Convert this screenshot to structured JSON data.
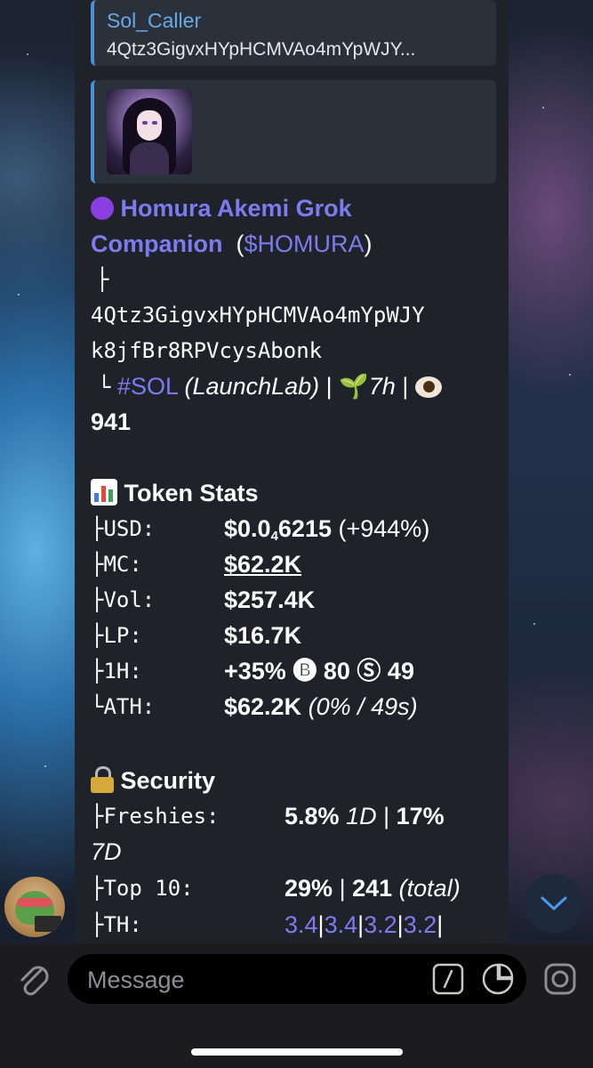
{
  "quote_reply": {
    "sender": "Sol_Caller",
    "preview": "4Qtz3GigvxHYpHCMVAo4mYpWJY..."
  },
  "token": {
    "name_line1": "Homura Akemi Grok",
    "name_line2": "Companion",
    "ticker": "$HOMURA",
    "tree_top": "├",
    "address_line1": "4Qtz3GigvxHYpHCMVAo4mYpWJY",
    "address_line2": "k8jfBr8RPVcysAbonk",
    "tree_end": "└",
    "chain_tag": "#SOL",
    "launchpad": "(LaunchLab)",
    "sep": "|",
    "age": "7h",
    "views": "941"
  },
  "stats": {
    "heading": "Token Stats",
    "rows": [
      {
        "prefix": "├USD:",
        "value_pre": "$0.0",
        "value_sub": "4",
        "value_post": "6215",
        "extra": "(+944%)"
      },
      {
        "prefix": "├MC:",
        "value": "$62.2K"
      },
      {
        "prefix": "├Vol:",
        "value": "$257.4K"
      },
      {
        "prefix": "├LP:",
        "value": "$16.7K"
      },
      {
        "prefix": "├1H:",
        "value": "+35%",
        "b_icon": "🅑",
        "b_val": "80",
        "s_icon": "Ⓢ",
        "s_val": "49"
      },
      {
        "prefix": "└ATH:",
        "value": "$62.2K",
        "extra": "(0% / 49s)"
      }
    ]
  },
  "security": {
    "heading": "Security",
    "freshies_prefix": "├Freshies:",
    "freshies_1d": "5.8%",
    "freshies_1d_label": "1D",
    "freshies_sep": "|",
    "freshies_7d": "17%",
    "freshies_7d_label": "7D",
    "top10_prefix": "├Top 10:",
    "top10_value": "29%",
    "top10_sep": "|",
    "top10_count": "241",
    "top10_label": "(total)",
    "th_prefix": "├TH:",
    "th_values": [
      "3.4",
      "3.4",
      "3.2",
      "3.2"
    ]
  },
  "composer": {
    "placeholder": "Message"
  },
  "colors": {
    "link": "#7c7cf0",
    "quote_accent": "#4c8fd6",
    "bubble_bg": "#1f2228"
  },
  "icons": [
    "purple-circle-icon",
    "seedling-icon",
    "eye-icon",
    "bar-chart-icon",
    "lock-icon",
    "paperclip-icon",
    "slash-command-icon",
    "sticker-icon",
    "camera-icon",
    "chevron-down-icon"
  ]
}
